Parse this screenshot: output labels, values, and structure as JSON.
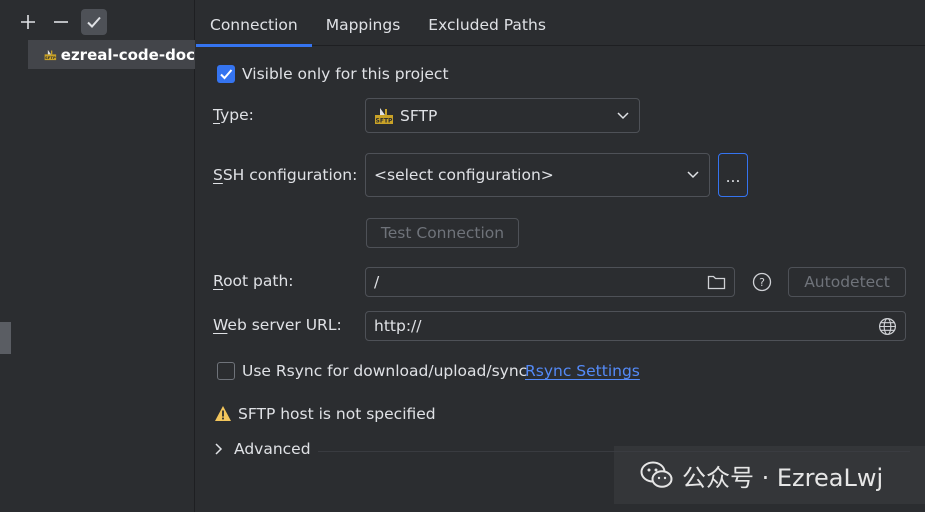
{
  "toolbar": {
    "add": "+",
    "remove": "−"
  },
  "servers": [
    {
      "name": "ezreal-code-doc",
      "icon": "sftp-server-icon"
    }
  ],
  "tabs": [
    {
      "label": "Connection",
      "selected": true
    },
    {
      "label": "Mappings",
      "selected": false
    },
    {
      "label": "Excluded Paths",
      "selected": false
    }
  ],
  "form": {
    "visible_only": {
      "label": "Visible only for this project",
      "checked": true
    },
    "type": {
      "label": "Type:",
      "value": "SFTP",
      "icon": "sftp-icon"
    },
    "ssh": {
      "label": "SSH configuration:",
      "value": "<select configuration>",
      "more": "..."
    },
    "test_connection": "Test Connection",
    "root_path": {
      "label": "Root path:",
      "value": "/",
      "autodetect": "Autodetect"
    },
    "web_server": {
      "label": "Web server URL:",
      "value": "http://"
    },
    "rsync": {
      "label": "Use Rsync for download/upload/sync",
      "checked": false,
      "link": "Rsync Settings"
    },
    "warning": "SFTP host is not specified",
    "advanced": "Advanced"
  },
  "watermark": "公众号 · EzreaLwj",
  "colors": {
    "accent": "#3574f0",
    "link": "#548af7",
    "warning": "#f2c55c",
    "background": "#2b2d30"
  }
}
